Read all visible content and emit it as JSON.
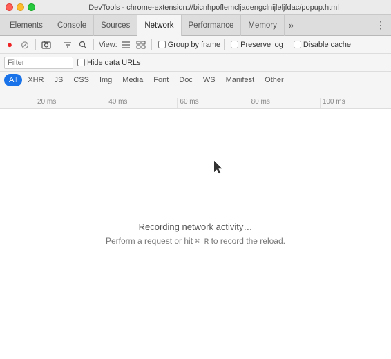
{
  "titleBar": {
    "title": "DevTools - chrome-extension://bicnhpoflemcljadengclnijleljfdac/popup.html"
  },
  "tabs": [
    {
      "id": "elements",
      "label": "Elements",
      "active": false
    },
    {
      "id": "console",
      "label": "Console",
      "active": false
    },
    {
      "id": "sources",
      "label": "Sources",
      "active": false
    },
    {
      "id": "network",
      "label": "Network",
      "active": true
    },
    {
      "id": "performance",
      "label": "Performance",
      "active": false
    },
    {
      "id": "memory",
      "label": "Memory",
      "active": false
    }
  ],
  "tabMore": "»",
  "tabKebab": "⋮",
  "toolbar": {
    "view_label": "View:",
    "group_by_frame_label": "Group by frame",
    "preserve_log_label": "Preserve log",
    "disable_cache_label": "Disable cache"
  },
  "filterBar": {
    "filter_placeholder": "Filter",
    "hide_data_urls_label": "Hide data URLs"
  },
  "typeFilters": [
    {
      "id": "all",
      "label": "All",
      "active": true
    },
    {
      "id": "xhr",
      "label": "XHR",
      "active": false
    },
    {
      "id": "js",
      "label": "JS",
      "active": false
    },
    {
      "id": "css",
      "label": "CSS",
      "active": false
    },
    {
      "id": "img",
      "label": "Img",
      "active": false
    },
    {
      "id": "media",
      "label": "Media",
      "active": false
    },
    {
      "id": "font",
      "label": "Font",
      "active": false
    },
    {
      "id": "doc",
      "label": "Doc",
      "active": false
    },
    {
      "id": "ws",
      "label": "WS",
      "active": false
    },
    {
      "id": "manifest",
      "label": "Manifest",
      "active": false
    },
    {
      "id": "other",
      "label": "Other",
      "active": false
    }
  ],
  "timeline": {
    "ticks": [
      "20 ms",
      "40 ms",
      "60 ms",
      "80 ms",
      "100 ms"
    ]
  },
  "mainContent": {
    "recording_text": "Recording network activity…",
    "hint_text": "Perform a request or hit",
    "hint_key": "⌘ R",
    "hint_suffix": "to record the reload."
  },
  "icons": {
    "record": "●",
    "stop": "⊘",
    "camera": "📷",
    "filter": "⊟",
    "search": "🔍"
  },
  "colors": {
    "active_tab_bg": "#f5f5f5",
    "inactive_tab_bg": "#ddd",
    "accent_blue": "#1a73e8"
  }
}
